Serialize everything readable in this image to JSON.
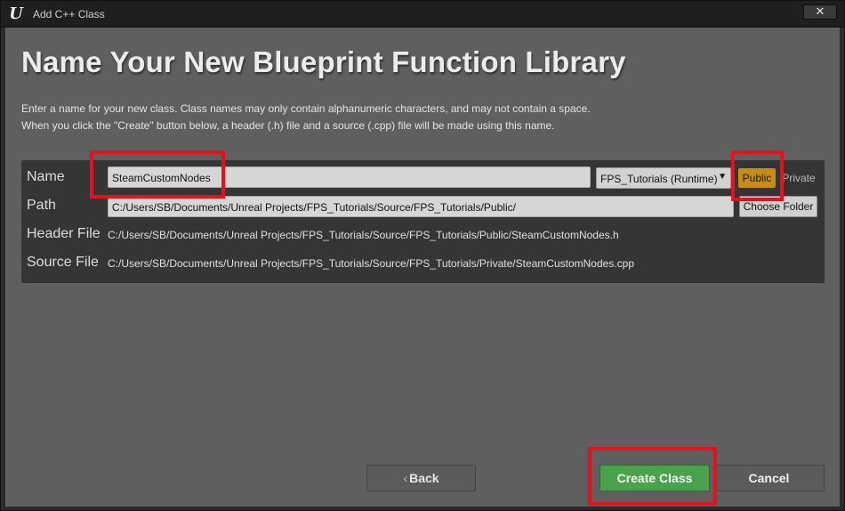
{
  "window": {
    "title": "Add C++ Class",
    "close_label": "✕",
    "logo_glyph": "U"
  },
  "heading": "Name Your New Blueprint Function Library",
  "description": {
    "line1": "Enter a name for your new class. Class names may only contain alphanumeric characters, and may not contain a space.",
    "line2": "When you click the \"Create\" button below, a header (.h) file and a source (.cpp) file will be made using this name."
  },
  "form": {
    "name_label": "Name",
    "name_value": "SteamCustomNodes",
    "module_value": "FPS_Tutorials (Runtime)",
    "module_caret": "▼",
    "public_label": "Public",
    "private_label": "Private",
    "path_label": "Path",
    "path_value": "C:/Users/SB/Documents/Unreal Projects/FPS_Tutorials/Source/FPS_Tutorials/Public/",
    "choose_folder_label": "Choose Folder",
    "header_label": "Header File",
    "header_value": "C:/Users/SB/Documents/Unreal Projects/FPS_Tutorials/Source/FPS_Tutorials/Public/SteamCustomNodes.h",
    "source_label": "Source File",
    "source_value": "C:/Users/SB/Documents/Unreal Projects/FPS_Tutorials/Source/FPS_Tutorials/Private/SteamCustomNodes.cpp"
  },
  "buttons": {
    "back_chevron": "‹",
    "back_label": "Back",
    "create_label": "Create Class",
    "cancel_label": "Cancel"
  },
  "colors": {
    "accent_public": "#c88d10",
    "create_green": "#4aa24c",
    "highlight_red": "#e8101c"
  }
}
